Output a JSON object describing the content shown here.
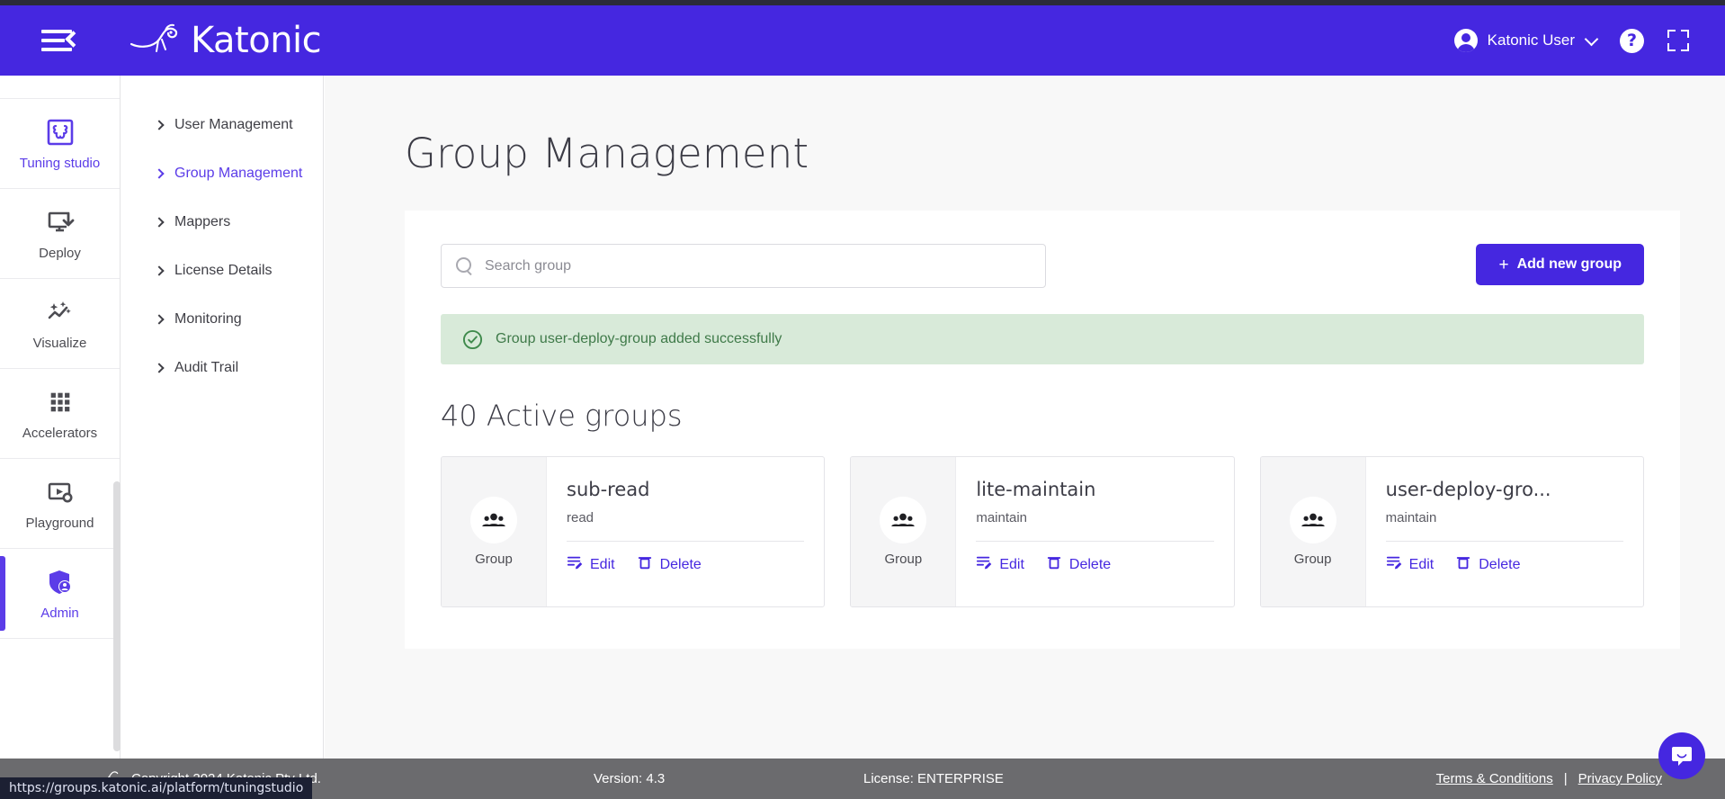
{
  "header": {
    "menu_icon": "hamburger-collapse-icon",
    "brand": "Katonic",
    "user_name": "Katonic User",
    "help_icon": "question-mark-icon",
    "fullscreen_icon": "fullscreen-icon"
  },
  "rail": {
    "items": [
      {
        "label": "Tuning studio",
        "icon": "puzzle-icon",
        "active": true
      },
      {
        "label": "Deploy",
        "icon": "deploy-download-icon",
        "active": false
      },
      {
        "label": "Visualize",
        "icon": "sparkle-chart-icon",
        "active": false
      },
      {
        "label": "Accelerators",
        "icon": "grid-dots-icon",
        "active": false
      },
      {
        "label": "Playground",
        "icon": "play-gear-icon",
        "active": false
      },
      {
        "label": "Admin",
        "icon": "shield-user-icon",
        "active": true
      }
    ]
  },
  "subnav": {
    "items": [
      {
        "label": "User Management",
        "active": false
      },
      {
        "label": "Group Management",
        "active": true
      },
      {
        "label": "Mappers",
        "active": false
      },
      {
        "label": "License Details",
        "active": false
      },
      {
        "label": "Monitoring",
        "active": false
      },
      {
        "label": "Audit Trail",
        "active": false
      }
    ]
  },
  "main": {
    "page_title": "Group Management",
    "search": {
      "placeholder": "Search group",
      "value": "",
      "icon": "search-icon"
    },
    "add_button": {
      "label": "Add new group",
      "plus": "+"
    },
    "alert": {
      "text": "Group user-deploy-group added successfully",
      "icon": "check-circle-icon",
      "color": "#3f7a49",
      "background": "#d8ead9"
    },
    "groups_count": "40 Active groups",
    "card_type_label": "Group",
    "edit_label": "Edit",
    "delete_label": "Delete",
    "cards": [
      {
        "name": "sub-read",
        "role": "read"
      },
      {
        "name": "lite-maintain",
        "role": "maintain"
      },
      {
        "name": "user-deploy-gro...",
        "role": "maintain"
      }
    ]
  },
  "footer": {
    "copyright": "Copyright 2024 Katonic Pty Ltd.",
    "version": "Version: 4.3",
    "license": "License: ENTERPRISE",
    "terms": "Terms & Conditions",
    "separator": "|",
    "privacy": "Privacy Policy"
  },
  "statusbar": {
    "url": "https://groups.katonic.ai/platform/tuningstudio"
  },
  "chat": {
    "icon": "chat-bubble-icon"
  },
  "colors": {
    "brand_purple": "#4527e0",
    "accent_purple": "#5b3ce8",
    "success_green": "#3f7a49",
    "footer_gray": "#6b6b6e"
  }
}
